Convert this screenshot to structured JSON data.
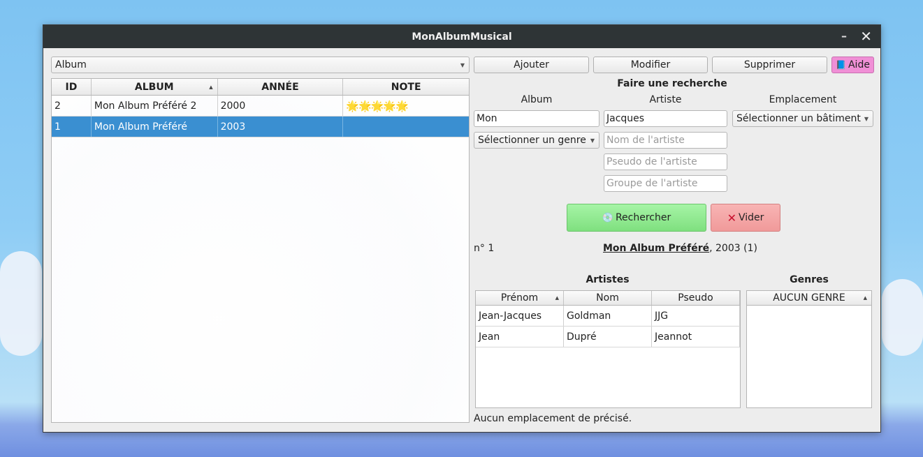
{
  "window": {
    "title": "MonAlbumMusical",
    "minimize": "–",
    "close": "✕"
  },
  "left": {
    "category_select": "Album",
    "columns": [
      "ID",
      "ALBUM",
      "ANNÉE",
      "NOTE"
    ],
    "rows": [
      {
        "id": "2",
        "album": "Mon Album Préféré 2",
        "annee": "2000",
        "note": "🌟🌟🌟🌟🌟",
        "selected": false
      },
      {
        "id": "1",
        "album": "Mon Album Préféré",
        "annee": "2003",
        "note": "",
        "selected": true
      }
    ]
  },
  "toolbar": {
    "ajouter": "Ajouter",
    "modifier": "Modifier",
    "supprimer": "Supprimer",
    "aide": "Aide"
  },
  "search": {
    "title": "Faire une recherche",
    "album_label": "Album",
    "artiste_label": "Artiste",
    "emplacement_label": "Emplacement",
    "album_value": "Mon",
    "artiste_value": "Jacques",
    "emplacement_select": "Sélectionner un bâtiment",
    "genre_select": "Sélectionner un genre",
    "nom_placeholder": "Nom de l'artiste",
    "pseudo_placeholder": "Pseudo de l'artiste",
    "groupe_placeholder": "Groupe de l'artiste",
    "rechercher": "Rechercher",
    "vider": "Vider"
  },
  "detail": {
    "numero": "n° 1",
    "album_title": "Mon Album Préféré",
    "album_suffix": ", 2003 (1)",
    "artistes_title": "Artistes",
    "genres_title": "Genres",
    "artist_columns": [
      "Prénom",
      "Nom",
      "Pseudo"
    ],
    "artists": [
      {
        "prenom": "Jean-Jacques",
        "nom": "Goldman",
        "pseudo": "JJG"
      },
      {
        "prenom": "Jean",
        "nom": "Dupré",
        "pseudo": "Jeannot"
      }
    ],
    "genre_column": "AUCUN GENRE",
    "emplacement_text": "Aucun emplacement de précisé."
  },
  "colors": {
    "selection": "#3a8fd1",
    "rechercher_bg": "#90ee90",
    "vider_bg": "#f5a3a3",
    "aide_bg": "#f08fd6"
  }
}
